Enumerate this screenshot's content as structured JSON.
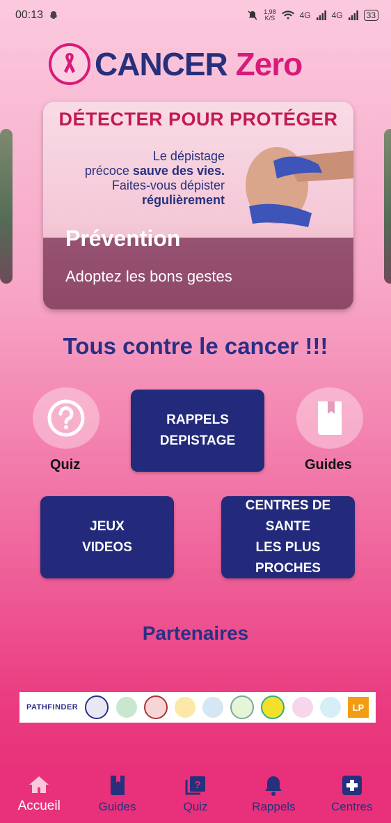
{
  "status_bar": {
    "time": "00:13",
    "speed_value": "1,98",
    "speed_unit": "K/S",
    "network1": "4G",
    "network2": "4G",
    "battery": "33"
  },
  "header": {
    "logo_word1": "CANCER",
    "logo_word2": "Zero"
  },
  "carousel": {
    "banner": "DÉTECTER POUR PROTÉGER",
    "copy_line1": "Le dépistage",
    "copy_line2_a": "précoce ",
    "copy_line2_b": "sauve des vies.",
    "copy_line3": "Faites-vous dépister",
    "copy_line4": "régulièrement",
    "title": "Prévention",
    "subtitle": "Adoptez les bons gestes"
  },
  "tagline": "Tous contre le cancer !!!",
  "actions": {
    "quiz_label": "Quiz",
    "guides_label": "Guides",
    "rappels_line1": "RAPPELS",
    "rappels_line2": "DEPISTAGE",
    "jeux_line1": "JEUX",
    "jeux_line2": "VIDEOS",
    "centres_line1": "CENTRES DE",
    "centres_line2": "SANTE",
    "centres_line3": "LES PLUS",
    "centres_line4": "PROCHES"
  },
  "partners": {
    "title": "Partenaires",
    "pathfinder": "PATHFINDER",
    "lp": "LP"
  },
  "bottom_nav": [
    {
      "label": "Accueil",
      "icon": "home-icon"
    },
    {
      "label": "Guides",
      "icon": "book-icon"
    },
    {
      "label": "Quiz",
      "icon": "quiz-icon"
    },
    {
      "label": "Rappels",
      "icon": "bell-icon"
    },
    {
      "label": "Centres",
      "icon": "medical-cross-icon"
    }
  ],
  "colors": {
    "navy": "#232a7c",
    "magenta": "#d81b7a",
    "nav_bg": "#e8317a"
  }
}
